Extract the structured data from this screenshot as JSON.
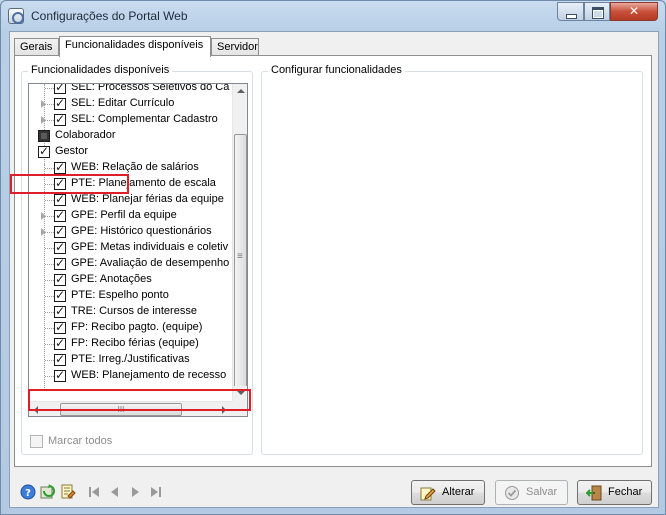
{
  "window": {
    "title": "Configurações do Portal Web"
  },
  "tabs": [
    {
      "label": "Gerais",
      "active": false
    },
    {
      "label": "Funcionalidades disponíveis",
      "active": true
    },
    {
      "label": "Servidor",
      "active": false
    }
  ],
  "left_group": {
    "title": "Funcionalidades disponíveis",
    "tree": [
      {
        "label": "SEL: Processos Seletivos do Ca",
        "checked": true,
        "expandable": false,
        "level": 1
      },
      {
        "label": "SEL: Editar Currículo",
        "checked": true,
        "expandable": true,
        "level": 1
      },
      {
        "label": "SEL: Complementar Cadastro",
        "checked": true,
        "expandable": true,
        "level": 1
      },
      {
        "label": "Colaborador",
        "checked": "partial",
        "expandable": false,
        "level": 0
      },
      {
        "label": "Gestor",
        "checked": true,
        "expandable": false,
        "level": 0
      },
      {
        "label": "WEB: Relação de salários",
        "checked": true,
        "expandable": false,
        "level": 1
      },
      {
        "label": "PTE: Planejamento de escala",
        "checked": true,
        "expandable": false,
        "level": 1
      },
      {
        "label": "WEB: Planejar férias da equipe",
        "checked": true,
        "expandable": false,
        "level": 1
      },
      {
        "label": "GPE: Perfil da equipe",
        "checked": true,
        "expandable": true,
        "level": 1
      },
      {
        "label": "GPE: Histórico questionários",
        "checked": true,
        "expandable": true,
        "level": 1
      },
      {
        "label": "GPE: Metas individuais e coletiv",
        "checked": true,
        "expandable": false,
        "level": 1
      },
      {
        "label": "GPE: Avaliação de desempenho",
        "checked": true,
        "expandable": false,
        "level": 1
      },
      {
        "label": "GPE: Anotações",
        "checked": true,
        "expandable": false,
        "level": 1
      },
      {
        "label": "PTE: Espelho ponto",
        "checked": true,
        "expandable": false,
        "level": 1
      },
      {
        "label": "TRE: Cursos de interesse",
        "checked": true,
        "expandable": false,
        "level": 1
      },
      {
        "label": "FP: Recibo pagto. (equipe)",
        "checked": true,
        "expandable": false,
        "level": 1
      },
      {
        "label": "FP: Recibo férias (equipe)",
        "checked": true,
        "expandable": false,
        "level": 1
      },
      {
        "label": "PTE: Irreg./Justificativas",
        "checked": true,
        "expandable": false,
        "level": 1
      },
      {
        "label": "WEB: Planejamento de recesso",
        "checked": true,
        "expandable": false,
        "level": 1
      }
    ],
    "scroll_h_grip": "III",
    "select_all_label": "Marcar todos"
  },
  "right_group": {
    "title": "Configurar funcionalidades"
  },
  "footer": {
    "icons": [
      "help-icon",
      "refresh-icon",
      "edit-list-icon"
    ],
    "nav": [
      "first-record-icon",
      "previous-record-icon",
      "next-record-icon",
      "last-record-icon"
    ],
    "alterar_label": "Alterar",
    "salvar_label": "Salvar",
    "fechar_label": "Fechar"
  },
  "colors": {
    "highlight": "#e01e2a",
    "frame": "#b3cae2"
  }
}
